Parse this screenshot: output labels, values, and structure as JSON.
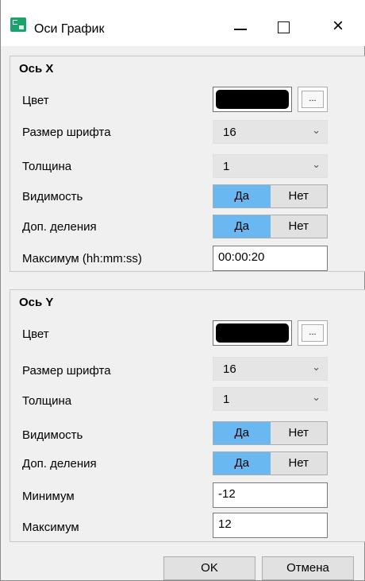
{
  "window": {
    "title": "Оси График",
    "close_glyph": "×"
  },
  "axis_x": {
    "title": "Ось X",
    "color_label": "Цвет",
    "color_value": "#000000",
    "color_button": "...",
    "font_size_label": "Размер шрифта",
    "font_size_value": "16",
    "thickness_label": "Толщина",
    "thickness_value": "1",
    "visibility_label": "Видимость",
    "visibility_yes": "Да",
    "visibility_no": "Нет",
    "minor_ticks_label": "Доп. деления",
    "minor_ticks_yes": "Да",
    "minor_ticks_no": "Нет",
    "max_label": "Максимум (hh:mm:ss)",
    "max_value": "00:00:20"
  },
  "axis_y": {
    "title": "Ось Y",
    "color_label": "Цвет",
    "color_value": "#000000",
    "color_button": "...",
    "font_size_label": "Размер шрифта",
    "font_size_value": "16",
    "thickness_label": "Толщина",
    "thickness_value": "1",
    "visibility_label": "Видимость",
    "visibility_yes": "Да",
    "visibility_no": "Нет",
    "minor_ticks_label": "Доп. деления",
    "minor_ticks_yes": "Да",
    "minor_ticks_no": "Нет",
    "min_label": "Минимум",
    "min_value": "-12",
    "max_label": "Максимум",
    "max_value": "12"
  },
  "footer": {
    "ok_label": "OK",
    "cancel_label": "Отмена"
  },
  "colors": {
    "toggle_active": "#6ab8f2",
    "toggle_inactive": "#e1e1e1",
    "app_icon": "#1aa36a"
  },
  "icons": {
    "app": "chart-axes-icon",
    "minimize": "minimize-icon",
    "maximize": "maximize-icon",
    "close": "close-icon",
    "dropdown": "chevron-down-icon"
  }
}
